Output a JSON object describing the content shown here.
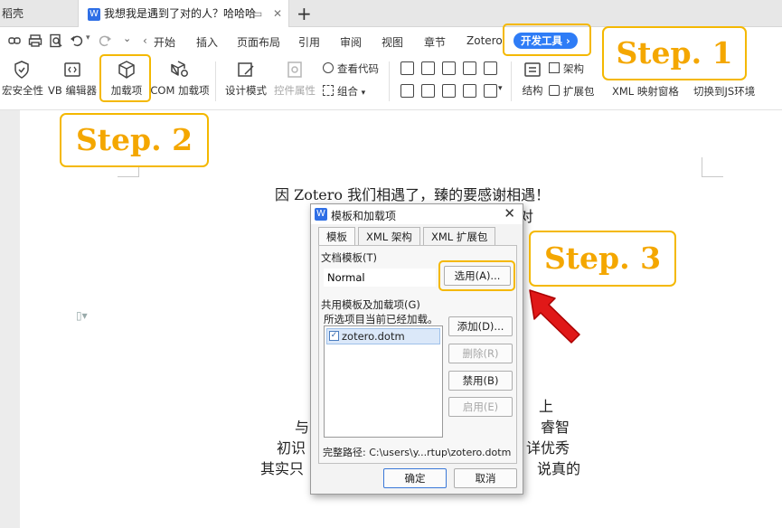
{
  "tabbar": {
    "prev_tab_label": "稻壳",
    "active_tab_label": "我想我是遇到了对的人？哈哈哈",
    "add_tab_label": "+"
  },
  "menu": {
    "items": [
      "开始",
      "插入",
      "页面布局",
      "引用",
      "审阅",
      "视图",
      "章节",
      "Zotero"
    ],
    "active": "开发工具",
    "active_arrow": "›",
    "left_arrow": "‹"
  },
  "ribbon": {
    "macro_security": "宏安全性",
    "vb_editor": "VB 编辑器",
    "addins": "加载项",
    "com_addins": "COM 加载项",
    "design_mode": "设计模式",
    "control_properties": "控件属性",
    "view_code": "查看代码",
    "group": "组合",
    "structure": "结构",
    "schema": "架构",
    "expansion_pack": "扩展包",
    "xml_mapping": "XML 映射窗格",
    "switch_js": "切换到JS环境"
  },
  "document": {
    "lines": [
      "因 Zotero 我们相遇了，臻的要感谢相遇！",
      "对",
      "上",
      "与",
      "睿智",
      "初识",
      "详优秀",
      "其实只",
      "说真的"
    ]
  },
  "dialog": {
    "title": "模板和加载项",
    "close": "✕",
    "tabs": [
      "模板",
      "XML 架构",
      "XML 扩展包"
    ],
    "doc_template_label": "文档模板(T)",
    "doc_template_value": "Normal",
    "select_button": "选用(A)...",
    "shared_label": "共用模板及加载项(G)",
    "loaded_note": "所选项目当前已经加载。",
    "list_items": [
      "zotero.dotm"
    ],
    "add_button": "添加(D)...",
    "delete_button": "删除(R)",
    "disable_button": "禁用(B)",
    "enable_button": "启用(E)",
    "full_path": "完整路径: C:\\users\\y...rtup\\zotero.dotm",
    "ok_button": "确定",
    "cancel_button": "取消"
  },
  "callouts": {
    "step1": "Step. 1",
    "step2": "Step. 2",
    "step3": "Step. 3"
  },
  "colors": {
    "accent": "#2e7cf6",
    "callout_border": "#f4b800",
    "callout_text": "#f4a700",
    "arrow": "#e01818"
  }
}
